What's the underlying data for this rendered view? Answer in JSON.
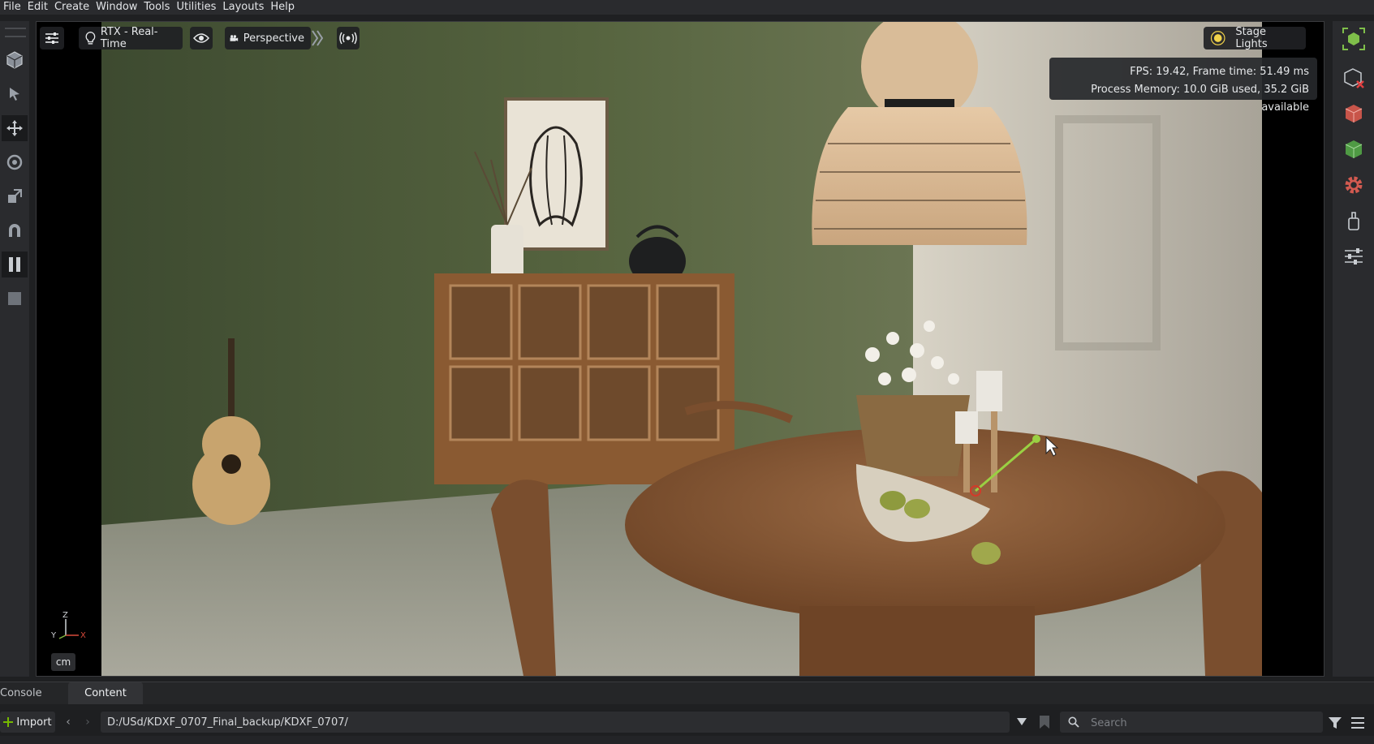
{
  "menu": [
    "File",
    "Edit",
    "Create",
    "Window",
    "Tools",
    "Utilities",
    "Layouts",
    "Help"
  ],
  "viewport": {
    "renderer_label": "RTX - Real-Time",
    "camera_label": "Perspective",
    "lights_label": "Stage Lights",
    "stats": {
      "fps_line": "FPS: 19.42, Frame time: 51.49 ms",
      "memory_line": "Process Memory: 10.0 GiB used, 35.2 GiB available"
    },
    "axes": {
      "z": "Z",
      "y": "Y",
      "x": "X"
    },
    "unit": "cm"
  },
  "left_tools": [
    "select-mode-icon",
    "cursor-select-icon",
    "move-icon",
    "rotate-icon",
    "scale-icon",
    "snap-magnet-icon",
    "pause-icon",
    "stop-icon"
  ],
  "right_tools": [
    "viewport-layout-icon",
    "disable-physics-icon",
    "red-cube-icon",
    "green-cube-icon",
    "gear-icon",
    "paint-icon",
    "settings-sliders-icon"
  ],
  "bottom": {
    "tabs": {
      "console": "Console",
      "content": "Content"
    },
    "import_label": "Import",
    "path": "D:/USd/KDXF_0707_Final_backup/KDXF_0707/",
    "search_placeholder": "Search"
  },
  "colors": {
    "accent_green": "#76b900",
    "panel_bg": "#2a2b2e",
    "viewport_bg": "#000000"
  }
}
